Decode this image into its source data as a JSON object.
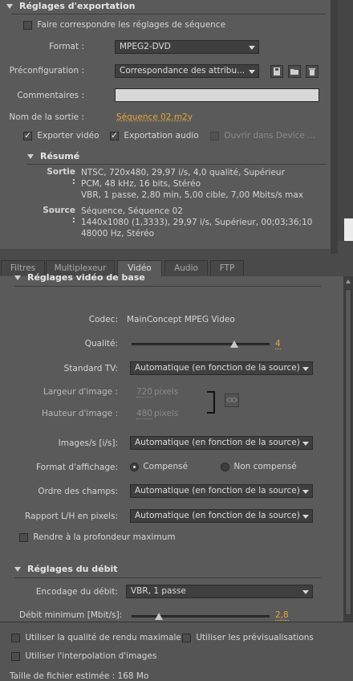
{
  "export": {
    "title": "Réglages d'exportation",
    "match_sequence": "Faire correspondre les réglages de séquence",
    "format_label": "Format :",
    "format_value": "MPEG2-DVD",
    "preset_label": "Préconfiguration :",
    "preset_value": "Correspondance des attribu...",
    "comments_label": "Commentaires :",
    "output_label": "Nom de la sortie :",
    "output_value": "Séquence 02.m2v",
    "export_video": "Exporter vidéo",
    "export_audio": "Exportation audio",
    "open_device": "Ouvrir dans Device ..."
  },
  "summary": {
    "title": "Résumé",
    "output_label": "Sortie :",
    "output_lines": [
      "NTSC, 720x480, 29,97 i/s, 4,0 qualité, Supérieur",
      "PCM, 48 kHz, 16 bits, Stéréo",
      "VBR, 1 passe, 2,80 min, 5,00 cible, 7,00 Mbits/s max"
    ],
    "source_label": "Source :",
    "source_lines": [
      "Séquence, Séquence 02",
      "1440x1080 (1,3333), 29,97 i/s, Supérieur, 00;03;36;10",
      "48000 Hz, Stéréo"
    ]
  },
  "tabs": [
    "Filtres",
    "Multiplexeur",
    "Vidéo",
    "Audio",
    "FTP"
  ],
  "video": {
    "title": "Réglages vidéo de base",
    "codec_label": "Codec:",
    "codec_value": "MainConcept MPEG Video",
    "quality_label": "Qualité:",
    "quality_value": "4",
    "tv_label": "Standard TV:",
    "tv_value": "Automatique (en fonction de la source)",
    "width_label": "Largeur d'image :",
    "width_value": "720",
    "height_label": "Hauteur d'image :",
    "height_value": "480",
    "pixels": "pixels",
    "fps_label": "Images/s [i/s]:",
    "fps_value": "Automatique (en fonction de la source)",
    "display_label": "Format d'affichage:",
    "compensated": "Compensé",
    "not_compensated": "Non compensé",
    "field_label": "Ordre des champs:",
    "field_value": "Automatique (en fonction de la source)",
    "ratio_label": "Rapport L/H en pixels:",
    "ratio_value": "Automatique (en fonction de la source)",
    "max_depth": "Rendre à la profondeur maximum"
  },
  "bitrate": {
    "title": "Réglages du débit",
    "encoding_label": "Encodage du débit:",
    "encoding_value": "VBR, 1 passe",
    "min_label": "Débit minimum [Mbit/s]:",
    "min_value": "2,8",
    "min_level_fraction": 0.2
  },
  "footer": {
    "max_quality": "Utiliser la qualité de rendu maximale",
    "previews": "Utiliser les prévisualisations",
    "interp": "Utiliser l'interpolation d'images",
    "filesize": "Taille de fichier estimée : 168 Mo"
  },
  "colors": {
    "accent": "#e8a53a"
  }
}
